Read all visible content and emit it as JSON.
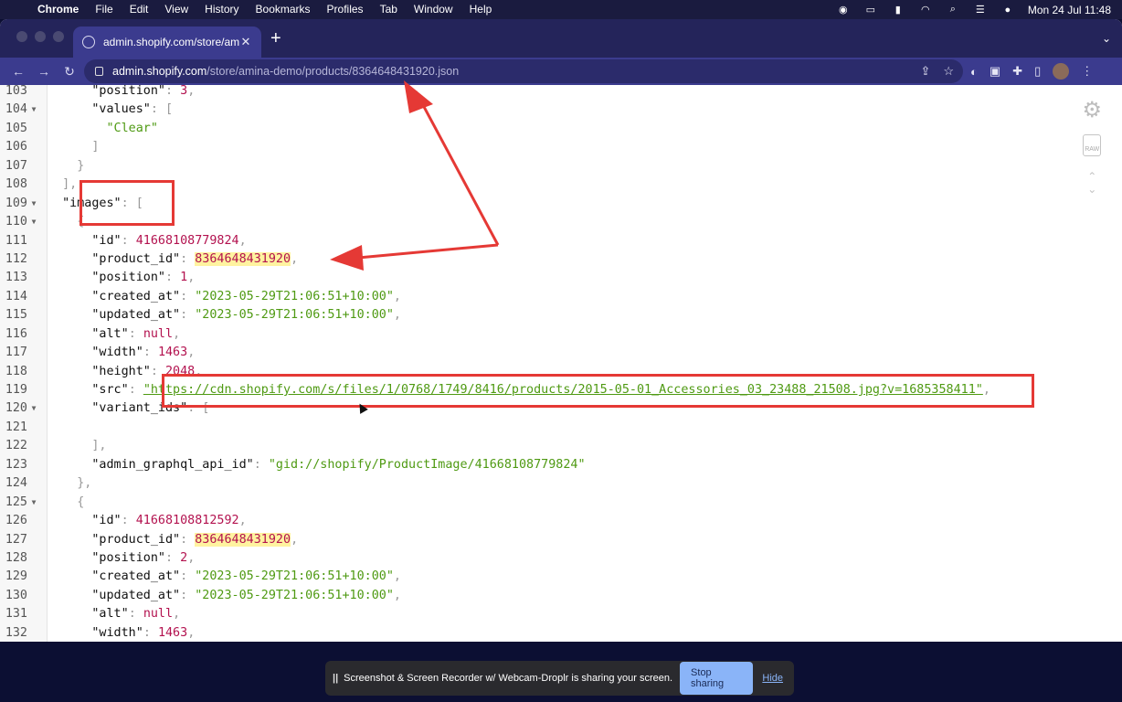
{
  "menubar": {
    "items": [
      "Chrome",
      "File",
      "Edit",
      "View",
      "History",
      "Bookmarks",
      "Profiles",
      "Tab",
      "Window",
      "Help"
    ],
    "datetime": "Mon 24 Jul  11:48"
  },
  "browser": {
    "tab_title": "admin.shopify.com/store/amina",
    "url_domain": "admin.shopify.com",
    "url_path": "/store/amina-demo/products/8364648431920.json"
  },
  "viewer": {
    "raw_label": "RAW",
    "lines": [
      {
        "n": "103",
        "fold": "",
        "indent": "      ",
        "parts": [
          [
            "k",
            "\"position\""
          ],
          [
            "p",
            ": "
          ],
          [
            "n",
            "3"
          ],
          [
            "p",
            ","
          ]
        ]
      },
      {
        "n": "104",
        "fold": "▼",
        "indent": "      ",
        "parts": [
          [
            "k",
            "\"values\""
          ],
          [
            "p",
            ": ["
          ]
        ]
      },
      {
        "n": "105",
        "fold": "",
        "indent": "        ",
        "parts": [
          [
            "s",
            "\"Clear\""
          ]
        ]
      },
      {
        "n": "106",
        "fold": "",
        "indent": "      ",
        "parts": [
          [
            "p",
            "]"
          ]
        ]
      },
      {
        "n": "107",
        "fold": "",
        "indent": "    ",
        "parts": [
          [
            "p",
            "}"
          ]
        ]
      },
      {
        "n": "108",
        "fold": "",
        "indent": "  ",
        "parts": [
          [
            "p",
            "],"
          ]
        ]
      },
      {
        "n": "109",
        "fold": "▼",
        "indent": "  ",
        "parts": [
          [
            "k",
            "\"images\""
          ],
          [
            "p",
            ": ["
          ]
        ]
      },
      {
        "n": "110",
        "fold": "▼",
        "indent": "    ",
        "parts": [
          [
            "p",
            "{"
          ]
        ]
      },
      {
        "n": "111",
        "fold": "",
        "indent": "      ",
        "parts": [
          [
            "k",
            "\"id\""
          ],
          [
            "p",
            ": "
          ],
          [
            "n",
            "41668108779824"
          ],
          [
            "p",
            ","
          ]
        ]
      },
      {
        "n": "112",
        "fold": "",
        "indent": "      ",
        "parts": [
          [
            "k",
            "\"product_id\""
          ],
          [
            "p",
            ": "
          ],
          [
            "nh",
            "8364648431920"
          ],
          [
            "p",
            ","
          ]
        ]
      },
      {
        "n": "113",
        "fold": "",
        "indent": "      ",
        "parts": [
          [
            "k",
            "\"position\""
          ],
          [
            "p",
            ": "
          ],
          [
            "n",
            "1"
          ],
          [
            "p",
            ","
          ]
        ]
      },
      {
        "n": "114",
        "fold": "",
        "indent": "      ",
        "parts": [
          [
            "k",
            "\"created_at\""
          ],
          [
            "p",
            ": "
          ],
          [
            "s",
            "\"2023-05-29T21:06:51+10:00\""
          ],
          [
            "p",
            ","
          ]
        ]
      },
      {
        "n": "115",
        "fold": "",
        "indent": "      ",
        "parts": [
          [
            "k",
            "\"updated_at\""
          ],
          [
            "p",
            ": "
          ],
          [
            "s",
            "\"2023-05-29T21:06:51+10:00\""
          ],
          [
            "p",
            ","
          ]
        ]
      },
      {
        "n": "116",
        "fold": "",
        "indent": "      ",
        "parts": [
          [
            "k",
            "\"alt\""
          ],
          [
            "p",
            ": "
          ],
          [
            "n",
            "null"
          ],
          [
            "p",
            ","
          ]
        ]
      },
      {
        "n": "117",
        "fold": "",
        "indent": "      ",
        "parts": [
          [
            "k",
            "\"width\""
          ],
          [
            "p",
            ": "
          ],
          [
            "n",
            "1463"
          ],
          [
            "p",
            ","
          ]
        ]
      },
      {
        "n": "118",
        "fold": "",
        "indent": "      ",
        "parts": [
          [
            "k",
            "\"height\""
          ],
          [
            "p",
            ": "
          ],
          [
            "n",
            "2048"
          ],
          [
            "p",
            ","
          ]
        ]
      },
      {
        "n": "119",
        "fold": "",
        "indent": "      ",
        "parts": [
          [
            "k",
            "\"src\""
          ],
          [
            "p",
            ": "
          ],
          [
            "u",
            "\"https://cdn.shopify.com/s/files/1/0768/1749/8416/products/2015-05-01_Accessories_03_23488_21508.jpg?v=1685358411\""
          ],
          [
            "p",
            ","
          ]
        ]
      },
      {
        "n": "120",
        "fold": "▼",
        "indent": "      ",
        "parts": [
          [
            "k",
            "\"variant_ids\""
          ],
          [
            "p",
            ": ["
          ]
        ]
      },
      {
        "n": "121",
        "fold": "",
        "indent": "",
        "parts": []
      },
      {
        "n": "122",
        "fold": "",
        "indent": "      ",
        "parts": [
          [
            "p",
            "],"
          ]
        ]
      },
      {
        "n": "123",
        "fold": "",
        "indent": "      ",
        "parts": [
          [
            "k",
            "\"admin_graphql_api_id\""
          ],
          [
            "p",
            ": "
          ],
          [
            "s",
            "\"gid://shopify/ProductImage/41668108779824\""
          ]
        ]
      },
      {
        "n": "124",
        "fold": "",
        "indent": "    ",
        "parts": [
          [
            "p",
            "},"
          ]
        ]
      },
      {
        "n": "125",
        "fold": "▼",
        "indent": "    ",
        "parts": [
          [
            "p",
            "{"
          ]
        ]
      },
      {
        "n": "126",
        "fold": "",
        "indent": "      ",
        "parts": [
          [
            "k",
            "\"id\""
          ],
          [
            "p",
            ": "
          ],
          [
            "n",
            "41668108812592"
          ],
          [
            "p",
            ","
          ]
        ]
      },
      {
        "n": "127",
        "fold": "",
        "indent": "      ",
        "parts": [
          [
            "k",
            "\"product_id\""
          ],
          [
            "p",
            ": "
          ],
          [
            "nh",
            "8364648431920"
          ],
          [
            "p",
            ","
          ]
        ]
      },
      {
        "n": "128",
        "fold": "",
        "indent": "      ",
        "parts": [
          [
            "k",
            "\"position\""
          ],
          [
            "p",
            ": "
          ],
          [
            "n",
            "2"
          ],
          [
            "p",
            ","
          ]
        ]
      },
      {
        "n": "129",
        "fold": "",
        "indent": "      ",
        "parts": [
          [
            "k",
            "\"created_at\""
          ],
          [
            "p",
            ": "
          ],
          [
            "s",
            "\"2023-05-29T21:06:51+10:00\""
          ],
          [
            "p",
            ","
          ]
        ]
      },
      {
        "n": "130",
        "fold": "",
        "indent": "      ",
        "parts": [
          [
            "k",
            "\"updated_at\""
          ],
          [
            "p",
            ": "
          ],
          [
            "s",
            "\"2023-05-29T21:06:51+10:00\""
          ],
          [
            "p",
            ","
          ]
        ]
      },
      {
        "n": "131",
        "fold": "",
        "indent": "      ",
        "parts": [
          [
            "k",
            "\"alt\""
          ],
          [
            "p",
            ": "
          ],
          [
            "n",
            "null"
          ],
          [
            "p",
            ","
          ]
        ]
      },
      {
        "n": "132",
        "fold": "",
        "indent": "      ",
        "parts": [
          [
            "k",
            "\"width\""
          ],
          [
            "p",
            ": "
          ],
          [
            "n",
            "1463"
          ],
          [
            "p",
            ","
          ]
        ]
      }
    ]
  },
  "sharing": {
    "message": "Screenshot & Screen Recorder w/ Webcam-Droplr is sharing your screen.",
    "stop_label": "Stop sharing",
    "hide_label": "Hide"
  },
  "colors": {
    "annotation": "#e53935",
    "highlight": "#fff3a0",
    "json_string": "#4f9a13",
    "json_number": "#b3124f"
  }
}
